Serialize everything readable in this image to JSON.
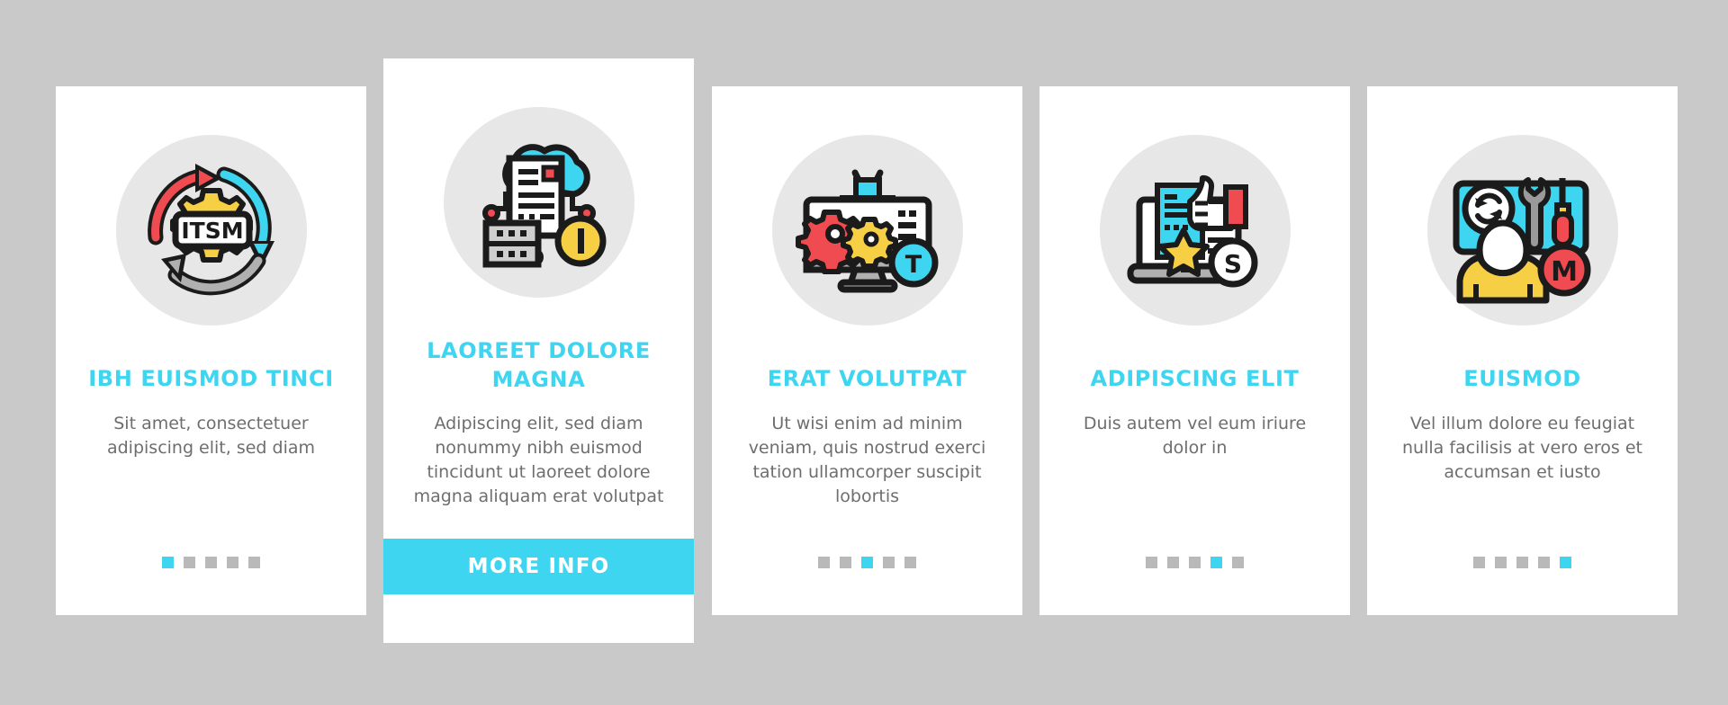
{
  "palette": {
    "background": "#c9c9c9",
    "card": "#ffffff",
    "accent": "#3ed5f0",
    "icon_circle": "#e7e7e7",
    "title": "#3ed5f0",
    "body_text": "#6e6e6e",
    "dot_inactive": "#b9b9b9",
    "red": "#ef4b50",
    "yellow": "#f6cf45",
    "gray": "#b0b0b0",
    "outline": "#1b1b1b"
  },
  "cards": [
    {
      "icon": "itsm-cycle-icon",
      "title": "IBH EUISMOD TINCI",
      "body": "Sit amet, consectetuer adipiscing elit, sed diam",
      "dots": {
        "count": 5,
        "active": 1
      },
      "cta": null
    },
    {
      "icon": "cloud-document-server-icon",
      "title": "LAOREET DOLORE MAGNA",
      "body": "Adipiscing elit, sed diam nonummy nibh euismod tincidunt ut laoreet dolore magna aliquam erat volutpat",
      "dots": null,
      "cta": "MORE INFO"
    },
    {
      "icon": "monitor-gears-robot-icon",
      "title": "ERAT VOLUTPAT",
      "body": "Ut wisi enim ad minim veniam, quis nostrud exerci tation ullamcorper suscipit lobortis",
      "dots": {
        "count": 5,
        "active": 3
      },
      "cta": null
    },
    {
      "icon": "laptop-thumbsup-star-icon",
      "title": "ADIPISCING ELIT",
      "body": "Duis autem vel eum iriure dolor in",
      "dots": {
        "count": 5,
        "active": 4
      },
      "cta": null
    },
    {
      "icon": "support-person-tools-icon",
      "title": "EUISMOD",
      "body": "Vel illum dolore eu feugiat nulla facilisis at vero eros et accumsan et iusto",
      "dots": {
        "count": 5,
        "active": 5
      },
      "cta": null
    }
  ],
  "icon_badges": {
    "card2_badge_letter": "I",
    "card3_badge_letter": "T",
    "card4_badge_letter": "S",
    "card5_badge_letter": "M",
    "card1_center_label": "ITSM"
  }
}
